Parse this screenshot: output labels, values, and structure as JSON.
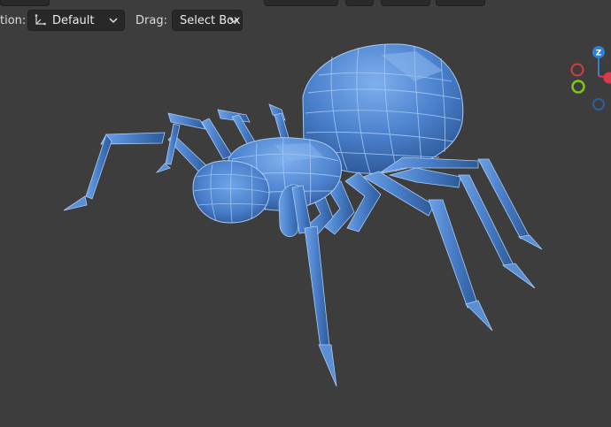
{
  "toolbar": {
    "orientation_label": "tion:",
    "orientation_value": "Default",
    "drag_label": "Drag:",
    "drag_value": "Select Box"
  },
  "gizmo": {
    "z_label": "Z",
    "colors": {
      "z": "#2f7fd6",
      "x": "#d9394a",
      "y": "#84c418",
      "neg_z": "#2d5f9c"
    }
  },
  "scene": {
    "background": "#3d3d3d",
    "mesh_color": "#4f86cf",
    "wire_color": "#a9ccf6",
    "object": "spider"
  }
}
